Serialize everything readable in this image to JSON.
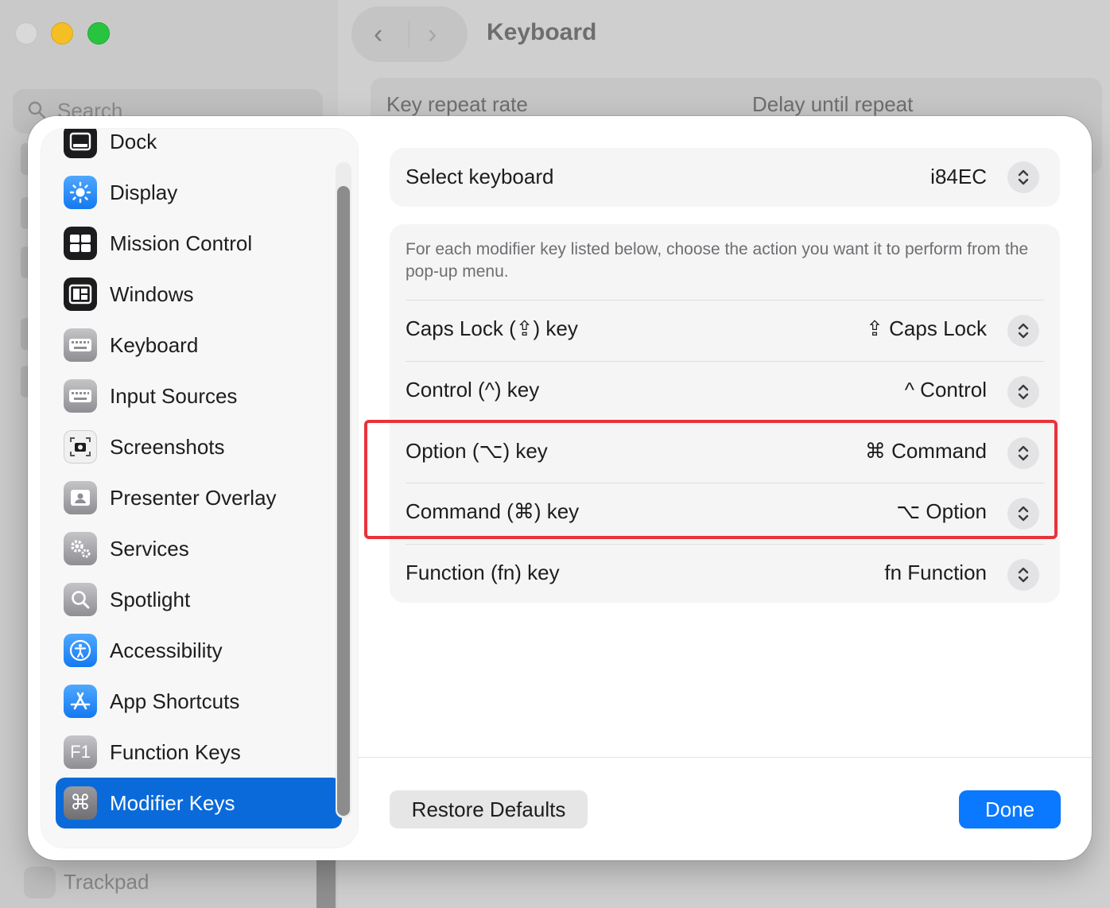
{
  "background": {
    "window_title": "Keyboard",
    "search_placeholder": "Search",
    "key_repeat_label": "Key repeat rate",
    "delay_label": "Delay until repeat",
    "bottom_item": "Trackpad"
  },
  "sidebar": {
    "items": [
      {
        "label": "Dock",
        "icon": "dock-icon"
      },
      {
        "label": "Display",
        "icon": "display-icon"
      },
      {
        "label": "Mission Control",
        "icon": "mission-control-icon"
      },
      {
        "label": "Windows",
        "icon": "windows-icon"
      },
      {
        "label": "Keyboard",
        "icon": "keyboard-icon"
      },
      {
        "label": "Input Sources",
        "icon": "input-sources-icon"
      },
      {
        "label": "Screenshots",
        "icon": "screenshots-icon"
      },
      {
        "label": "Presenter Overlay",
        "icon": "presenter-overlay-icon"
      },
      {
        "label": "Services",
        "icon": "services-icon"
      },
      {
        "label": "Spotlight",
        "icon": "spotlight-icon"
      },
      {
        "label": "Accessibility",
        "icon": "accessibility-icon"
      },
      {
        "label": "App Shortcuts",
        "icon": "app-shortcuts-icon"
      },
      {
        "label": "Function Keys",
        "icon": "function-keys-icon"
      },
      {
        "label": "Modifier Keys",
        "icon": "modifier-keys-icon",
        "selected": true
      }
    ],
    "function_keys_glyph": "F1",
    "modifier_glyph": "⌘"
  },
  "keyboard_select": {
    "label": "Select keyboard",
    "value": "i84EC"
  },
  "modifiers": {
    "description": "For each modifier key listed below, choose the action you want it to perform from the pop-up menu.",
    "rows": [
      {
        "label": "Caps Lock (⇪) key",
        "value": "⇪ Caps Lock"
      },
      {
        "label": "Control (^) key",
        "value": "^ Control"
      },
      {
        "label": "Option (⌥) key",
        "value": "⌘ Command"
      },
      {
        "label": "Command (⌘) key",
        "value": "⌥ Option"
      },
      {
        "label": "Function (fn) key",
        "value": "fn Function"
      }
    ]
  },
  "footer": {
    "restore_label": "Restore Defaults",
    "done_label": "Done"
  },
  "colors": {
    "accent": "#0a78ff",
    "selected": "#0a6ad9",
    "highlight": "#e8333a"
  }
}
